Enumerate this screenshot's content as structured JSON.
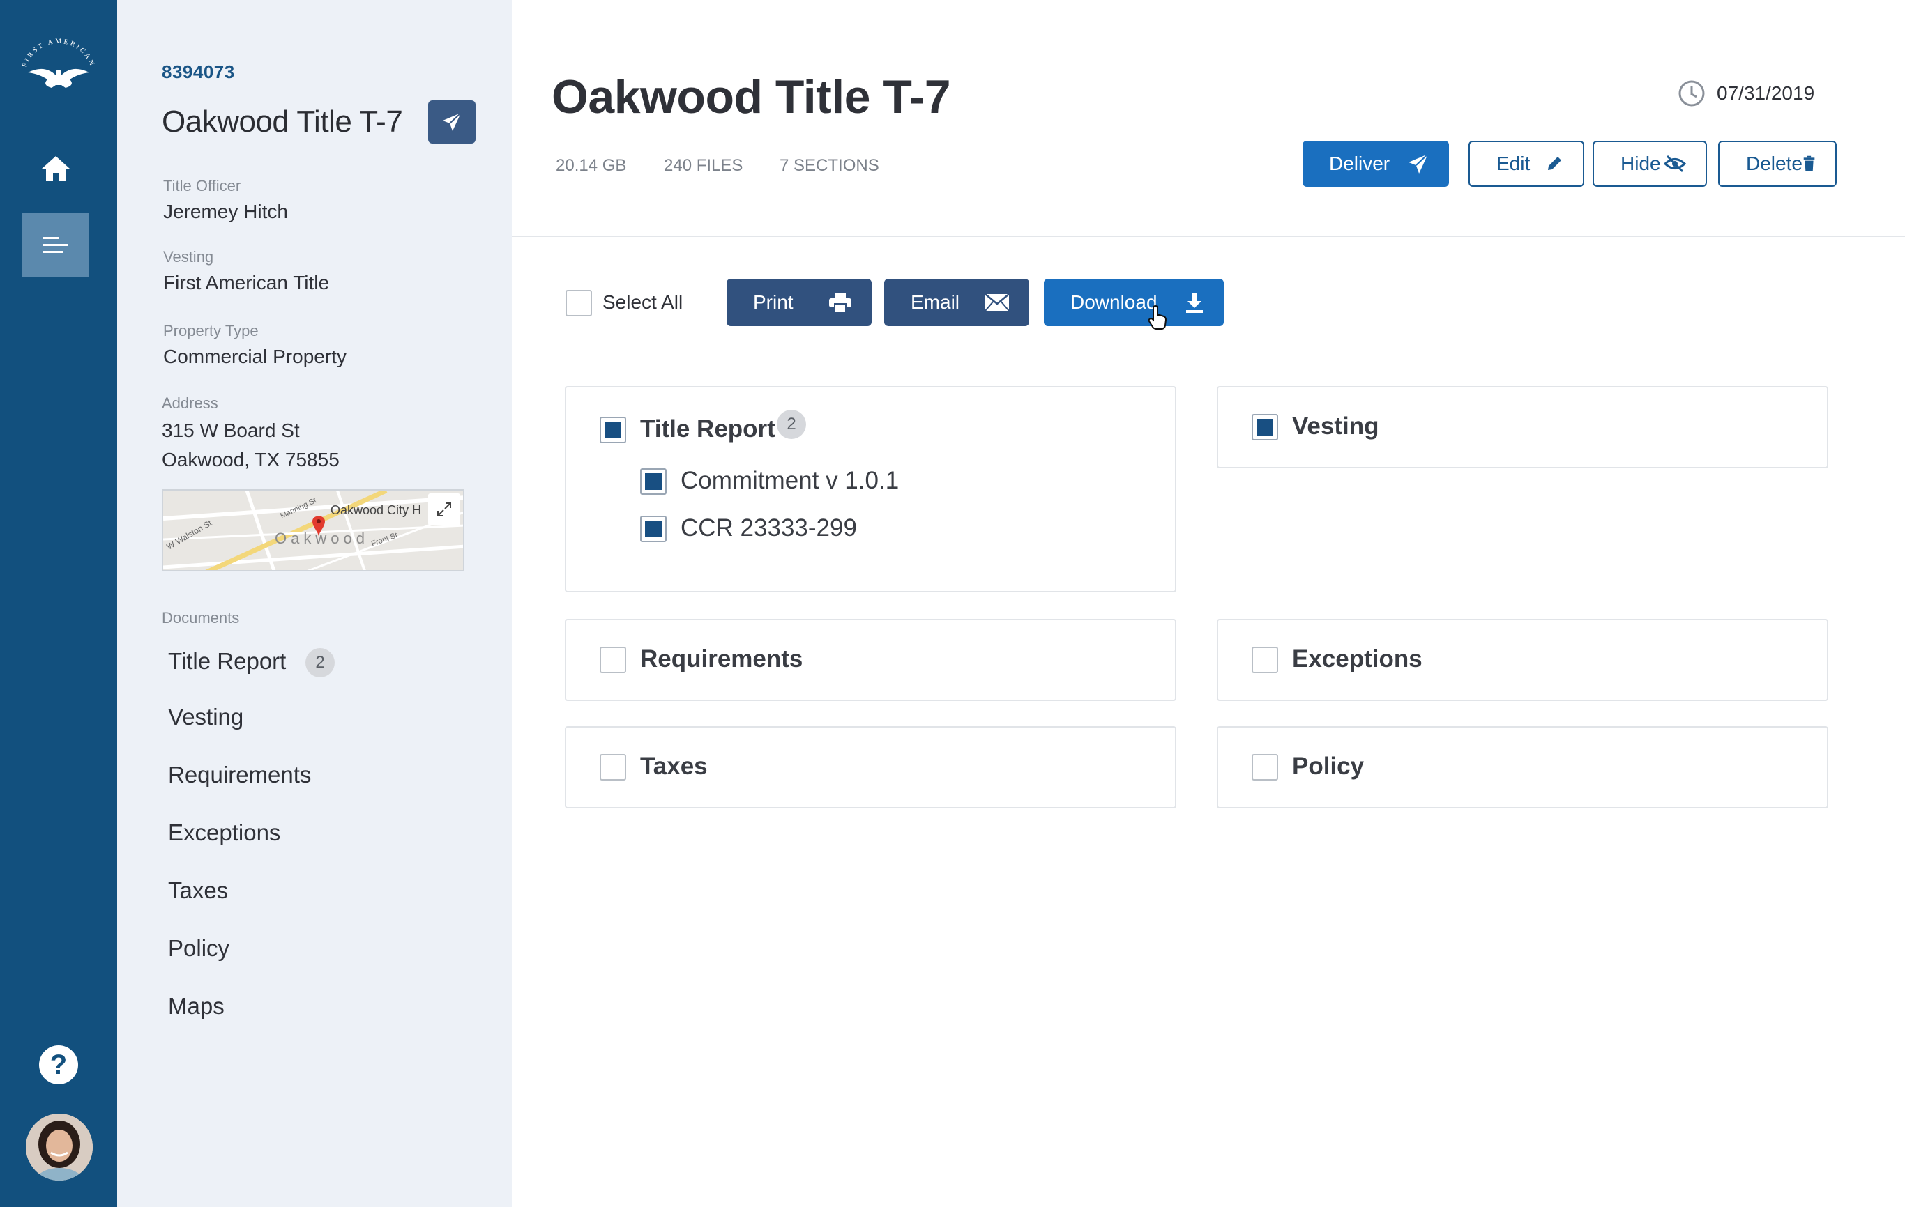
{
  "brand": {
    "name": "FIRST AMERICAN",
    "accent": "#12507e"
  },
  "rail": {
    "items": [
      {
        "name": "home",
        "icon": "home-icon"
      },
      {
        "name": "documents",
        "icon": "list-icon",
        "active": true
      }
    ],
    "help_label": "?",
    "help_icon": "help-icon",
    "avatar_icon": "user-avatar"
  },
  "sidebar": {
    "id": "8394073",
    "title": "Oakwood Title T-7",
    "fields": [
      {
        "label": "Title Officer",
        "value": "Jeremey Hitch"
      },
      {
        "label": "Vesting",
        "value": "First American Title"
      },
      {
        "label": "Property Type",
        "value": "Commercial Property"
      },
      {
        "label": "Address",
        "value": "315 W Board St",
        "value2": "Oakwood, TX 75855"
      }
    ],
    "map": {
      "labels": [
        "Oakwood City H",
        "Oakwood",
        "W Walston St",
        "Manning St",
        "Front St"
      ]
    },
    "documents_label": "Documents",
    "documents": [
      {
        "label": "Title Report",
        "count": "2"
      },
      {
        "label": "Vesting"
      },
      {
        "label": "Requirements"
      },
      {
        "label": "Exceptions"
      },
      {
        "label": "Taxes"
      },
      {
        "label": "Policy"
      },
      {
        "label": "Maps"
      }
    ]
  },
  "header": {
    "title": "Oakwood Title T-7",
    "size": "20.14 GB",
    "files": "240 FILES",
    "sections": "7 SECTIONS",
    "date": "07/31/2019",
    "actions": {
      "deliver": "Deliver",
      "edit": "Edit",
      "hide": "Hide",
      "delete": "Delete"
    }
  },
  "toolbar": {
    "select_all": "Select All",
    "print": "Print",
    "email": "Email",
    "download": "Download"
  },
  "sections": {
    "title_report": {
      "label": "Title Report",
      "count": "2",
      "checked": true,
      "children": [
        {
          "label": "Commitment v 1.0.1",
          "checked": true
        },
        {
          "label": "CCR 23333-299",
          "checked": true
        }
      ]
    },
    "vesting": {
      "label": "Vesting",
      "checked": true
    },
    "requirements": {
      "label": "Requirements",
      "checked": false
    },
    "exceptions": {
      "label": "Exceptions",
      "checked": false
    },
    "taxes": {
      "label": "Taxes",
      "checked": false
    },
    "policy": {
      "label": "Policy",
      "checked": false
    }
  },
  "colors": {
    "rail": "#12507e",
    "sidebar_bg": "#edf1f7",
    "primary": "#1a6fbf",
    "dark_button": "#31517e",
    "checkbox_fill": "#184f82"
  }
}
